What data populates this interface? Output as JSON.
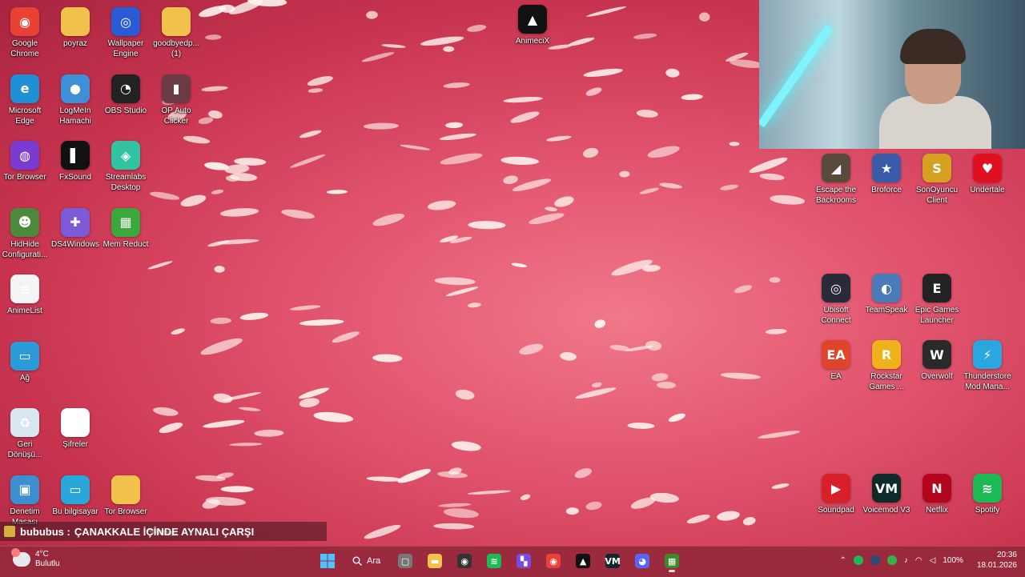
{
  "desktop_icons": [
    {
      "name": "google-chrome-shortcut",
      "label": "Google Chrome",
      "glyph": "◉",
      "color": "#e94235",
      "col": 0,
      "row": 0
    },
    {
      "name": "poyraz-folder",
      "label": "poyraz",
      "glyph": "",
      "color": "#f2c14b",
      "col": 1,
      "row": 0
    },
    {
      "name": "wallpaper-engine-shortcut",
      "label": "Wallpaper Engine",
      "glyph": "◎",
      "color": "#2a5bd7",
      "col": 2,
      "row": 0
    },
    {
      "name": "goodbyedp-folder",
      "label": "goodbyedp... (1)",
      "glyph": "",
      "color": "#f2c14b",
      "col": 3,
      "row": 0
    },
    {
      "name": "microsoft-edge-shortcut",
      "label": "Microsoft Edge",
      "glyph": "e",
      "color": "#1f8fd6",
      "col": 0,
      "row": 1
    },
    {
      "name": "logmein-hamachi-shortcut",
      "label": "LogMeIn Hamachi",
      "glyph": "●",
      "color": "#3f8fd8",
      "col": 1,
      "row": 1
    },
    {
      "name": "obs-studio-shortcut",
      "label": "OBS Studio",
      "glyph": "◔",
      "color": "#222222",
      "col": 2,
      "row": 1
    },
    {
      "name": "op-auto-clicker-shortcut",
      "label": "OP Auto Clicker",
      "glyph": "▮",
      "color": "#6a3b45",
      "col": 3,
      "row": 1
    },
    {
      "name": "tor-browser-shortcut",
      "label": "Tor Browser",
      "glyph": "◍",
      "color": "#7a3bd1",
      "col": 0,
      "row": 2
    },
    {
      "name": "fxsound-shortcut",
      "label": "FxSound",
      "glyph": "▌",
      "color": "#111111",
      "col": 1,
      "row": 2
    },
    {
      "name": "streamlabs-desktop-shortcut",
      "label": "Streamlabs Desktop",
      "glyph": "◈",
      "color": "#31c3a2",
      "col": 2,
      "row": 2
    },
    {
      "name": "hidhide-configuration-shortcut",
      "label": "HidHide Configurati...",
      "glyph": "☻",
      "color": "#4b8a3a",
      "col": 0,
      "row": 3
    },
    {
      "name": "ds4windows-shortcut",
      "label": "DS4Windows",
      "glyph": "✚",
      "color": "#7d5ad6",
      "col": 1,
      "row": 3
    },
    {
      "name": "mem-reduct-shortcut",
      "label": "Mem Reduct",
      "glyph": "▦",
      "color": "#3aa83a",
      "col": 2,
      "row": 3
    },
    {
      "name": "animelist-file",
      "label": "AnimeList",
      "glyph": "≡",
      "color": "#f4f4f4",
      "col": 0,
      "row": 4
    },
    {
      "name": "network-icon",
      "label": "Ağ",
      "glyph": "▭",
      "color": "#2a9bd8",
      "col": 0,
      "row": 5
    },
    {
      "name": "recycle-bin-icon",
      "label": "Geri Dönüşü...",
      "glyph": "♻",
      "color": "#d8e6ef",
      "col": 0,
      "row": 6
    },
    {
      "name": "sifreler-file",
      "label": "Şifreler",
      "glyph": "",
      "color": "#ffffff",
      "col": 1,
      "row": 6
    },
    {
      "name": "control-panel-icon",
      "label": "Denetim Masası",
      "glyph": "▣",
      "color": "#3b8fd1",
      "col": 0,
      "row": 7
    },
    {
      "name": "this-pc-icon",
      "label": "Bu bilgisayar",
      "glyph": "▭",
      "color": "#29a7d8",
      "col": 1,
      "row": 7
    },
    {
      "name": "tor-browser-folder",
      "label": "Tor Browser",
      "glyph": "",
      "color": "#f2c14b",
      "col": 2,
      "row": 7
    }
  ],
  "top_center_icon": {
    "label": "AnimeciX",
    "glyph": "▲",
    "color": "#111111"
  },
  "right_icons": [
    {
      "name": "escape-the-backrooms-shortcut",
      "label": "Escape the Backrooms",
      "glyph": "◢",
      "color": "#5a4a3a",
      "col": 0,
      "row": 0
    },
    {
      "name": "broforce-shortcut",
      "label": "Broforce",
      "glyph": "★",
      "color": "#3a5ca8",
      "col": 1,
      "row": 0
    },
    {
      "name": "sonoyuncu-client-shortcut",
      "label": "SonOyuncu Client",
      "glyph": "S",
      "color": "#d8a020",
      "col": 2,
      "row": 0
    },
    {
      "name": "undertale-shortcut",
      "label": "Undertale",
      "glyph": "♥",
      "color": "#e01020",
      "col": 3,
      "row": 0
    },
    {
      "name": "ubisoft-connect-shortcut",
      "label": "Ubisoft Connect",
      "glyph": "◎",
      "color": "#2a2a3a",
      "col": 0,
      "row": 1
    },
    {
      "name": "teamspeak-shortcut",
      "label": "TeamSpeak",
      "glyph": "◐",
      "color": "#4a7ab8",
      "col": 1,
      "row": 1
    },
    {
      "name": "epic-games-launcher-shortcut",
      "label": "Epic Games Launcher",
      "glyph": "E",
      "color": "#222222",
      "col": 2,
      "row": 1
    },
    {
      "name": "ea-shortcut",
      "label": "EA",
      "glyph": "EA",
      "color": "#e0442a",
      "col": 0,
      "row": 2
    },
    {
      "name": "rockstar-games-shortcut",
      "label": "Rockstar Games ...",
      "glyph": "R",
      "color": "#f0b21a",
      "col": 1,
      "row": 2
    },
    {
      "name": "overwolf-shortcut",
      "label": "Overwolf",
      "glyph": "W",
      "color": "#2a2a2a",
      "col": 2,
      "row": 2
    },
    {
      "name": "thunderstore-mod-manager-shortcut",
      "label": "Thunderstore Mod Mana...",
      "glyph": "⚡",
      "color": "#2aa6e0",
      "col": 3,
      "row": 2
    },
    {
      "name": "soundpad-shortcut",
      "label": "Soundpad",
      "glyph": "▶",
      "color": "#d8202a",
      "col": 0,
      "row": 3
    },
    {
      "name": "voicemod-v3-shortcut",
      "label": "Voicemod V3",
      "glyph": "VM",
      "color": "#0f2a2a",
      "col": 1,
      "row": 3
    },
    {
      "name": "netflix-shortcut",
      "label": "Netflix",
      "glyph": "N",
      "color": "#b3061e",
      "col": 2,
      "row": 3
    },
    {
      "name": "spotify-shortcut",
      "label": "Spotify",
      "glyph": "≋",
      "color": "#1db954",
      "col": 3,
      "row": 3
    }
  ],
  "chat": {
    "user": "bububus :",
    "message": "ÇANAKKALE İÇİNDE AYNALI ÇARŞI"
  },
  "taskbar": {
    "weather_temp": "4°C",
    "weather_desc": "Bulutlu",
    "search_label": "Ara",
    "apps": [
      {
        "name": "task-view-icon",
        "glyph": "▢",
        "color": "#777777"
      },
      {
        "name": "file-explorer-icon",
        "glyph": "▬",
        "color": "#f2c14b"
      },
      {
        "name": "github-app-icon",
        "glyph": "◉",
        "color": "#333333"
      },
      {
        "name": "spotify-taskbar-icon",
        "glyph": "≋",
        "color": "#1db954"
      },
      {
        "name": "clapper-app-icon",
        "glyph": "▚",
        "color": "#7b4be0"
      },
      {
        "name": "chrome-taskbar-icon",
        "glyph": "◉",
        "color": "#e94235"
      },
      {
        "name": "animecix-taskbar-icon",
        "glyph": "▲",
        "color": "#111111"
      },
      {
        "name": "voicemod-taskbar-icon",
        "glyph": "VM",
        "color": "#0f2a2a"
      },
      {
        "name": "discord-taskbar-icon",
        "glyph": "◕",
        "color": "#5865f2"
      },
      {
        "name": "minecraft-taskbar-icon",
        "glyph": "▦",
        "color": "#3a8a2a"
      }
    ],
    "battery": "100%",
    "time": "20:36",
    "date": "18.01.2026"
  }
}
